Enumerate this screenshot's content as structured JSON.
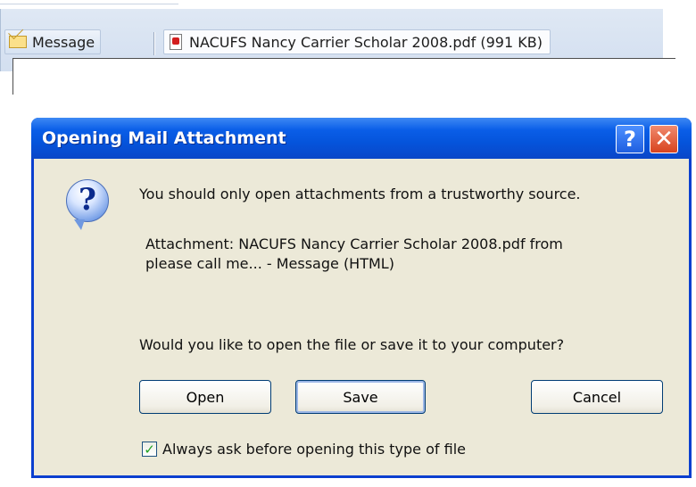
{
  "attachment_bar": {
    "message_label": "Message",
    "file_label": "NACUFS Nancy Carrier Scholar 2008.pdf (991 KB)"
  },
  "dialog": {
    "title": "Opening Mail Attachment",
    "help_glyph": "?",
    "close_glyph": "✕",
    "warning": "You should only open attachments from a trustworthy source.",
    "attachment_line1": "Attachment: NACUFS Nancy Carrier Scholar 2008.pdf from",
    "attachment_line2": "please call me... - Message (HTML)",
    "question": "Would you like to open the file or save it to your computer?",
    "buttons": {
      "open": "Open",
      "save": "Save",
      "cancel": "Cancel"
    },
    "checkbox": {
      "label": "Always ask before opening this type of file",
      "checked": true
    },
    "colors": {
      "title_bar": "#0a5ee8",
      "dialog_bg": "#ece9d8",
      "close_button": "#d8431e"
    }
  }
}
